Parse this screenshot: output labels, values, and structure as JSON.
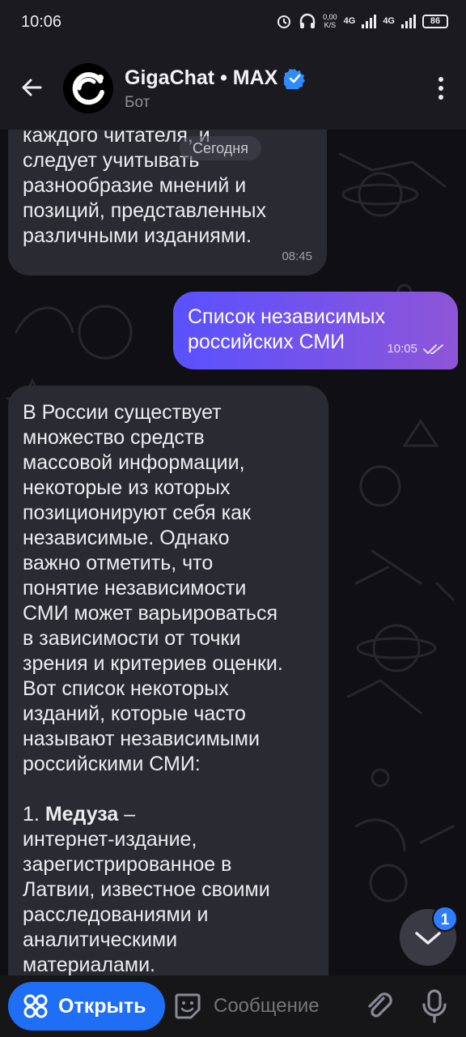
{
  "status_bar": {
    "time": "10:06",
    "net_speed_value": "0,00",
    "net_speed_unit": "K/S",
    "sim1": "4G",
    "sim2": "4G",
    "battery": "86"
  },
  "header": {
    "title": "GigaChat • MAX",
    "subtitle": "Бот",
    "icons": [
      "back-arrow-icon",
      "gigachat-logo-icon",
      "verified-badge-icon",
      "more-vertical-icon"
    ]
  },
  "chat": {
    "date_separator": "Сегодня",
    "messages": [
      {
        "direction": "incoming",
        "text": "каждого читателя, и\nследует учитывать\nразнообразие мнений и\nпозиций, представленных\nразличными изданиями.",
        "time": "08:45"
      },
      {
        "direction": "outgoing",
        "text": "Список независимых\nроссийских СМИ",
        "time": "10:05",
        "status_icon": "double-check-icon"
      },
      {
        "direction": "incoming",
        "text": "В России существует\nмножество средств\nмассовой информации,\nнекоторые из которых\nпозиционируют себя как\nнезависимые. Однако\nважно отметить, что\nпонятие независимости\nСМИ может варьироваться\nв зависимости от точки\nзрения и критериев оценки.\nВот список некоторых\nизданий, которые часто\nназывают независимыми\nроссийскими СМИ:",
        "list_item_number": "1.",
        "list_item_title": "Медуза",
        "list_item_dash": "–",
        "list_item_text": "интернет-издание,\nзарегистрированное в\nЛатвии, известное своими\nрасследованиями и\nаналитическими\nматериалами."
      }
    ],
    "scroll_down": {
      "icon": "chevron-down-icon",
      "unread_count": "1"
    }
  },
  "bottom_bar": {
    "open_button_label": "Открыть",
    "open_button_icon": "apps-grid-icon",
    "message_placeholder": "Сообщение",
    "icons": [
      "sticker-icon",
      "attach-paperclip-icon",
      "microphone-icon"
    ]
  },
  "colors": {
    "background": "#101014",
    "header": "#1b1b1f",
    "incoming_bubble": "#2a2a33",
    "outgoing_gradient_start": "#5a51ff",
    "outgoing_gradient_end": "#8e55d8",
    "accent": "#1e6ff5",
    "badge": "#2f7cff"
  }
}
